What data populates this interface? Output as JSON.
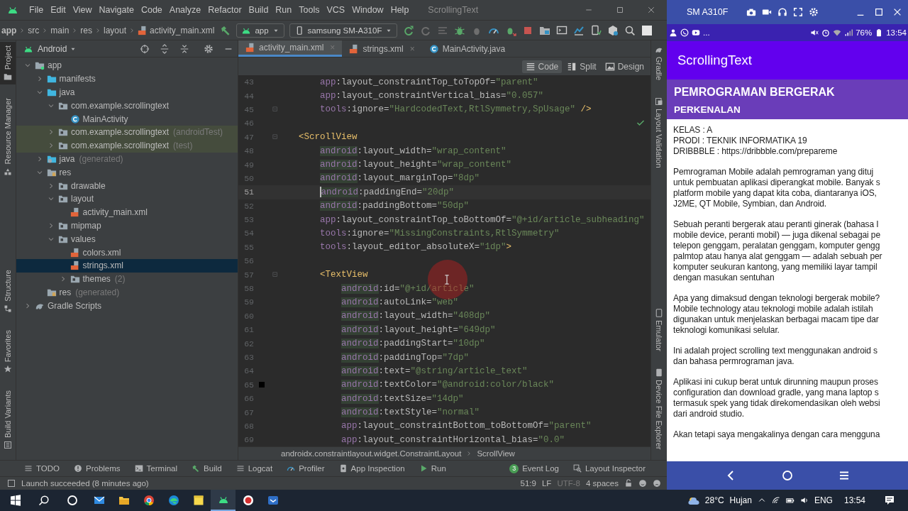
{
  "menubar": {
    "items": [
      "File",
      "Edit",
      "View",
      "Navigate",
      "Code",
      "Analyze",
      "Refactor",
      "Build",
      "Run",
      "Tools",
      "VCS",
      "Window",
      "Help"
    ],
    "title": "ScrollingText"
  },
  "breadcrumbs": [
    "app",
    "src",
    "main",
    "res",
    "layout",
    "activity_main.xml"
  ],
  "run_config": "app",
  "device": "samsung SM-A310F",
  "tool_strip_left": {
    "top": [
      {
        "label": "Project",
        "selected": true
      },
      {
        "label": "Resource Manager",
        "selected": false
      }
    ],
    "bottom": [
      {
        "label": "Structure",
        "selected": false
      },
      {
        "label": "Favorites",
        "selected": false
      },
      {
        "label": "Build Variants",
        "selected": false
      }
    ]
  },
  "project": {
    "view": "Android",
    "tree": [
      {
        "label": "app",
        "kind": "module",
        "expanded": true,
        "selected": false,
        "children": [
          {
            "label": "manifests",
            "kind": "folder",
            "expanded": false,
            "selected": false
          },
          {
            "label": "java",
            "kind": "folder",
            "expanded": true,
            "selected": false,
            "children": [
              {
                "label": "com.example.scrollingtext",
                "kind": "package",
                "expanded": true,
                "selected": false,
                "children": [
                  {
                    "label": "MainActivity",
                    "kind": "class",
                    "selected": false
                  }
                ]
              },
              {
                "label": "com.example.scrollingtext",
                "note": "(androidTest)",
                "kind": "package",
                "expanded": false,
                "selected": false,
                "tinted": true
              },
              {
                "label": "com.example.scrollingtext",
                "note": "(test)",
                "kind": "package",
                "expanded": false,
                "selected": false,
                "tinted": true
              }
            ]
          },
          {
            "label": "java",
            "note": "(generated)",
            "kind": "generated",
            "expanded": false,
            "selected": false
          },
          {
            "label": "res",
            "kind": "res",
            "expanded": true,
            "selected": false,
            "children": [
              {
                "label": "drawable",
                "kind": "package",
                "expanded": false,
                "selected": false
              },
              {
                "label": "layout",
                "kind": "package",
                "expanded": true,
                "selected": false,
                "children": [
                  {
                    "label": "activity_main.xml",
                    "kind": "xml",
                    "selected": false
                  }
                ]
              },
              {
                "label": "mipmap",
                "kind": "package",
                "expanded": false,
                "selected": false
              },
              {
                "label": "values",
                "kind": "package",
                "expanded": true,
                "selected": false,
                "children": [
                  {
                    "label": "colors.xml",
                    "kind": "xml",
                    "selected": false
                  },
                  {
                    "label": "strings.xml",
                    "kind": "xml",
                    "selected": true
                  },
                  {
                    "label": "themes",
                    "note": "(2)",
                    "kind": "package",
                    "expanded": false,
                    "selected": false
                  }
                ]
              }
            ]
          },
          {
            "label": "res",
            "note": "(generated)",
            "kind": "res",
            "selected": false
          }
        ]
      },
      {
        "label": "Gradle Scripts",
        "kind": "gradle",
        "expanded": false,
        "selected": false
      }
    ]
  },
  "tabs": [
    {
      "label": "activity_main.xml",
      "kind": "xml",
      "selected": true,
      "close": "×"
    },
    {
      "label": "strings.xml",
      "kind": "xml",
      "selected": false,
      "close": "×"
    },
    {
      "label": "MainActivity.java",
      "kind": "class",
      "selected": false
    }
  ],
  "editor_modes": [
    {
      "label": "Code",
      "kind": "code",
      "selected": true
    },
    {
      "label": "Split",
      "kind": "split",
      "selected": false
    },
    {
      "label": "Design",
      "kind": "design",
      "selected": false
    }
  ],
  "code": {
    "children": [
      {
        "children": [
          {
            "number": "43",
            "kind": "attr",
            "ns": "app",
            "text": ":layout_constraintTop_toTopOf=",
            "value": "\"parent\""
          },
          {
            "number": "44",
            "kind": "attr",
            "ns": "app",
            "text": ":layout_constraintVertical_bias=",
            "value": "\"0.057\""
          },
          {
            "number": "45",
            "kind": "attr",
            "ns": "tools",
            "text": ":ignore=",
            "value": "\"HardcodedText,RtlSymmetry,SpUsage\"",
            "suffix": " />"
          }
        ]
      },
      {
        "number": "46",
        "kind": "blank"
      },
      {
        "number": "47",
        "kind": "tag",
        "text": "<ScrollView",
        "children": [
          {
            "number": "48",
            "kind": "attr",
            "ns": "android",
            "text": ":layout_width=",
            "value": "\"wrap_content\"",
            "highlighted": true
          },
          {
            "number": "49",
            "kind": "attr",
            "ns": "android",
            "text": ":layout_height=",
            "value": "\"wrap_content\"",
            "highlighted": true
          },
          {
            "number": "50",
            "kind": "attr",
            "ns": "android",
            "text": ":layout_marginTop=",
            "value": "\"8dp\"",
            "highlighted": true
          },
          {
            "number": "51",
            "kind": "attr",
            "ns": "android",
            "text": ":paddingEnd=",
            "value": "\"20dp\"",
            "highlighted": true,
            "current": true
          },
          {
            "number": "52",
            "kind": "attr",
            "ns": "android",
            "text": ":paddingBottom=",
            "value": "\"50dp\"",
            "highlighted": true
          },
          {
            "number": "53",
            "kind": "attr",
            "ns": "app",
            "text": ":layout_constraintTop_toBottomOf=",
            "value": "\"@+id/article_subheading\""
          },
          {
            "number": "54",
            "kind": "attr",
            "ns": "tools",
            "text": ":ignore=",
            "value": "\"MissingConstraints,RtlSymmetry\""
          },
          {
            "number": "55",
            "kind": "attr",
            "ns": "tools",
            "text": ":layout_editor_absoluteX=",
            "value": "\"1dp\"",
            "suffix": ">"
          },
          {
            "number": "56",
            "kind": "blank"
          },
          {
            "number": "57",
            "kind": "tag",
            "text": "<TextView",
            "children": [
              {
                "number": "58",
                "kind": "attr",
                "ns": "android",
                "text": ":id=",
                "value": "\"@+id/article\"",
                "highlighted": true
              },
              {
                "number": "59",
                "kind": "attr",
                "ns": "android",
                "text": ":autoLink=",
                "value": "\"web\"",
                "highlighted": true
              },
              {
                "number": "60",
                "kind": "attr",
                "ns": "android",
                "text": ":layout_width=",
                "value": "\"408dp\"",
                "highlighted": true
              },
              {
                "number": "61",
                "kind": "attr",
                "ns": "android",
                "text": ":layout_height=",
                "value": "\"649dp\"",
                "highlighted": true
              },
              {
                "number": "62",
                "kind": "attr",
                "ns": "android",
                "text": ":paddingStart=",
                "value": "\"10dp\"",
                "highlighted": true
              },
              {
                "number": "63",
                "kind": "attr",
                "ns": "android",
                "text": ":paddingTop=",
                "value": "\"7dp\"",
                "highlighted": true
              },
              {
                "number": "64",
                "kind": "attr",
                "ns": "android",
                "text": ":text=",
                "value": "\"@string/article_text\"",
                "highlighted": true
              },
              {
                "number": "65",
                "kind": "attr",
                "ns": "android",
                "text": ":textColor=",
                "value": "\"@android:color/black\"",
                "highlighted": true,
                "color": "#000000"
              },
              {
                "number": "66",
                "kind": "attr",
                "ns": "android",
                "text": ":textSize=",
                "value": "\"14dp\"",
                "highlighted": true
              },
              {
                "number": "67",
                "kind": "attr",
                "ns": "android",
                "text": ":textStyle=",
                "value": "\"normal\"",
                "highlighted": true
              },
              {
                "number": "68",
                "kind": "attr",
                "ns": "app",
                "text": ":layout_constraintBottom_toBottomOf=",
                "value": "\"parent\""
              },
              {
                "number": "69",
                "kind": "attr",
                "ns": "app",
                "text": ":layout_constraintHorizontal_bias=",
                "value": "\"0.0\""
              }
            ]
          }
        ]
      }
    ]
  },
  "element_path": [
    "androidx.constraintlayout.widget.ConstraintLayout",
    "ScrollView"
  ],
  "tool_strip_right": {
    "top": [
      "Gradle",
      "Layout Validation"
    ],
    "bottom": [
      "Emulator",
      "Device File Explorer"
    ]
  },
  "tool_windows": {
    "left": [
      {
        "label": "TODO",
        "kind": "list"
      },
      {
        "label": "Problems",
        "kind": "problems"
      },
      {
        "label": "Terminal",
        "kind": "terminal"
      },
      {
        "label": "Build",
        "kind": "hammer"
      },
      {
        "label": "Logcat",
        "kind": "list"
      },
      {
        "label": "Profiler",
        "kind": "gauge"
      },
      {
        "label": "App Inspection",
        "kind": "inspect"
      },
      {
        "label": "Run",
        "kind": "run"
      }
    ],
    "right": [
      {
        "label": "Event Log",
        "badge": "3"
      },
      {
        "label": "Layout Inspector"
      }
    ]
  },
  "status_bar": {
    "message": "Launch succeeded (8 minutes ago)",
    "items": [
      "51:9",
      "LF",
      "UTF-8",
      "4 spaces"
    ]
  },
  "phone": {
    "device": "SM A310F",
    "status_more": "...",
    "battery": "76%",
    "time": "13:54",
    "app_title": "ScrollingText",
    "heading": "PEMROGRAMAN BERGERAK",
    "subheading": "PERKENALAN",
    "article": [
      [
        "KELAS : A",
        "PRODI : TEKNIK INFORMATIKA 19",
        "DRIBBBLE : https://dribbble.com/prepareme"
      ],
      [
        "Pemrograman Mobile adalah pemrograman yang dituj",
        "untuk pembuatan aplikasi diperangkat mobile. Banyak s",
        "platform mobile yang dapat kita coba, diantaranya iOS,",
        "J2ME, QT Mobile, Symbian, dan Android."
      ],
      [
        "Sebuah peranti bergerak atau peranti ginerak (bahasa I",
        "mobile device, peranti mobil) — juga dikenal sebagai pe",
        "telepon genggam, peralatan genggam, komputer gengg",
        "palmtop atau hanya alat genggam — adalah sebuah per",
        "komputer seukuran kantong, yang memiliki layar tampil",
        "dengan masukan sentuhan"
      ],
      [
        "Apa yang dimaksud dengan teknologi bergerak mobile?",
        "Mobile technology atau teknologi mobile adalah istilah",
        "digunakan untuk menjelaskan berbagai macam tipe dar",
        "teknologi komunikasi selular."
      ],
      [
        "Ini adalah project scrolling text menggunakan android s",
        "dan bahasa permrograman java."
      ],
      [
        "Aplikasi ini cukup berat untuk dirunning maupun proses",
        "configuration dan download gradle, yang mana laptop s",
        "termasuk spek yang tidak direkomendasikan oleh websi",
        "dari android studio."
      ],
      [
        "Akan tetapi saya mengakalinya dengan cara mengguna"
      ]
    ]
  },
  "taskbar": {
    "apps": [
      {
        "kind": "mail",
        "selected": false
      },
      {
        "kind": "explorer",
        "selected": false
      },
      {
        "kind": "chrome",
        "selected": false
      },
      {
        "kind": "edge",
        "selected": false
      },
      {
        "kind": "notes",
        "selected": false
      },
      {
        "kind": "android",
        "selected": true
      },
      {
        "kind": "recorder",
        "selected": false
      },
      {
        "kind": "app",
        "selected": false
      }
    ],
    "temperature": "28°C",
    "weather": "Hujan",
    "language": "ENG",
    "time": "13:54"
  }
}
